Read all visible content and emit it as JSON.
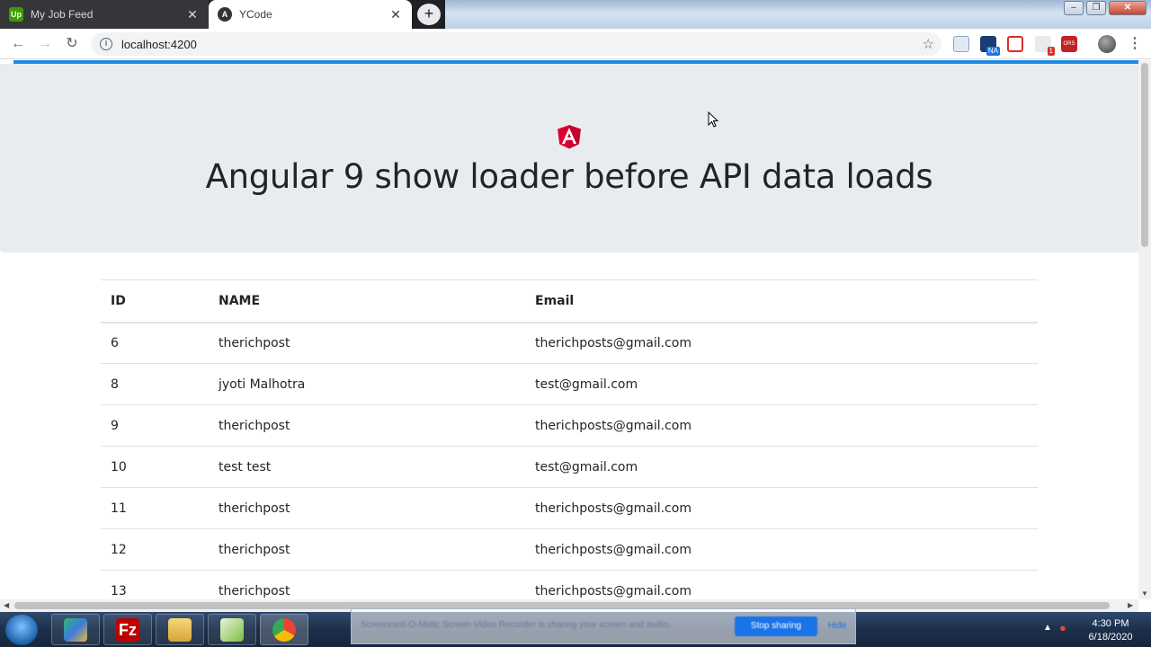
{
  "browser": {
    "tabs": [
      {
        "title": "My Job Feed",
        "favicon": "Up",
        "active": false
      },
      {
        "title": "YCode",
        "favicon": "A",
        "active": true
      }
    ],
    "address": "localhost:4200",
    "new_tab_symbol": "+",
    "window_controls": [
      "–",
      "❐",
      "✕"
    ],
    "extension_badge": "1",
    "extension_badge_na": "NA",
    "extension_label_ors": "ORS"
  },
  "page": {
    "heading": "Angular 9 show loader before API data loads",
    "loader_color": "#1e88e5",
    "table": {
      "headers": [
        "ID",
        "NAME",
        "Email"
      ],
      "rows": [
        [
          "6",
          "therichpost",
          "therichposts@gmail.com"
        ],
        [
          "8",
          "jyoti Malhotra",
          "test@gmail.com"
        ],
        [
          "9",
          "therichpost",
          "therichposts@gmail.com"
        ],
        [
          "10",
          "test test",
          "test@gmail.com"
        ],
        [
          "11",
          "therichpost",
          "therichposts@gmail.com"
        ],
        [
          "12",
          "therichpost",
          "therichposts@gmail.com"
        ],
        [
          "13",
          "therichpost",
          "therichposts@gmail.com"
        ]
      ]
    }
  },
  "recorder": {
    "message": "Screencast-O-Matic Screen Video Recorder is sharing your screen and audio.",
    "stop_label": "Stop sharing",
    "hide_label": "Hide"
  },
  "taskbar": {
    "time": "4:30 PM",
    "date": "6/18/2020",
    "apps": [
      "gitkraken",
      "filezilla",
      "file-explorer",
      "notepad-plus-plus",
      "chrome"
    ]
  }
}
